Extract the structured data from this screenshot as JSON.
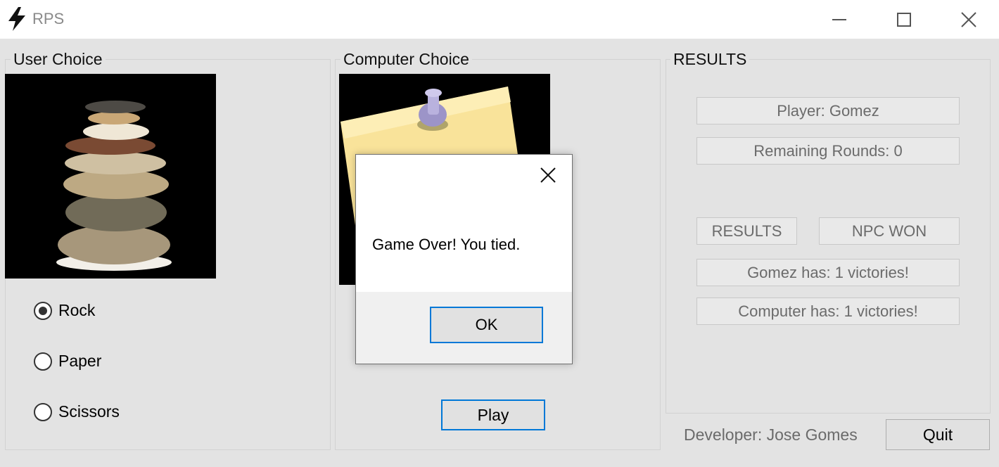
{
  "window": {
    "title": "RPS",
    "icon": "lightning-bolt-icon",
    "controls": [
      "minimize-icon",
      "maximize-icon",
      "close-icon"
    ]
  },
  "user_panel": {
    "label": "User Choice",
    "image": "stacked-stones-image",
    "options": [
      {
        "label": "Rock",
        "checked": true
      },
      {
        "label": "Paper",
        "checked": false
      },
      {
        "label": "Scissors",
        "checked": false
      }
    ]
  },
  "computer_panel": {
    "label": "Computer Choice",
    "image": "pinned-paper-note-image",
    "play_label": "Play"
  },
  "results_panel": {
    "label": "RESULTS",
    "player": "Player: Gomez",
    "remaining": "Remaining Rounds: 0",
    "results_button": "RESULTS",
    "outcome": "NPC WON",
    "player_victories": "Gomez has: 1 victories!",
    "computer_victories": "Computer has: 1 victories!"
  },
  "footer": {
    "developer": "Developer: Jose Gomes",
    "quit_label": "Quit"
  },
  "dialog": {
    "message": "Game Over! You tied.",
    "ok_label": "OK"
  },
  "colors": {
    "accent": "#0078d7",
    "background": "#e3e3e3",
    "muted_text": "#6b6b6b"
  }
}
